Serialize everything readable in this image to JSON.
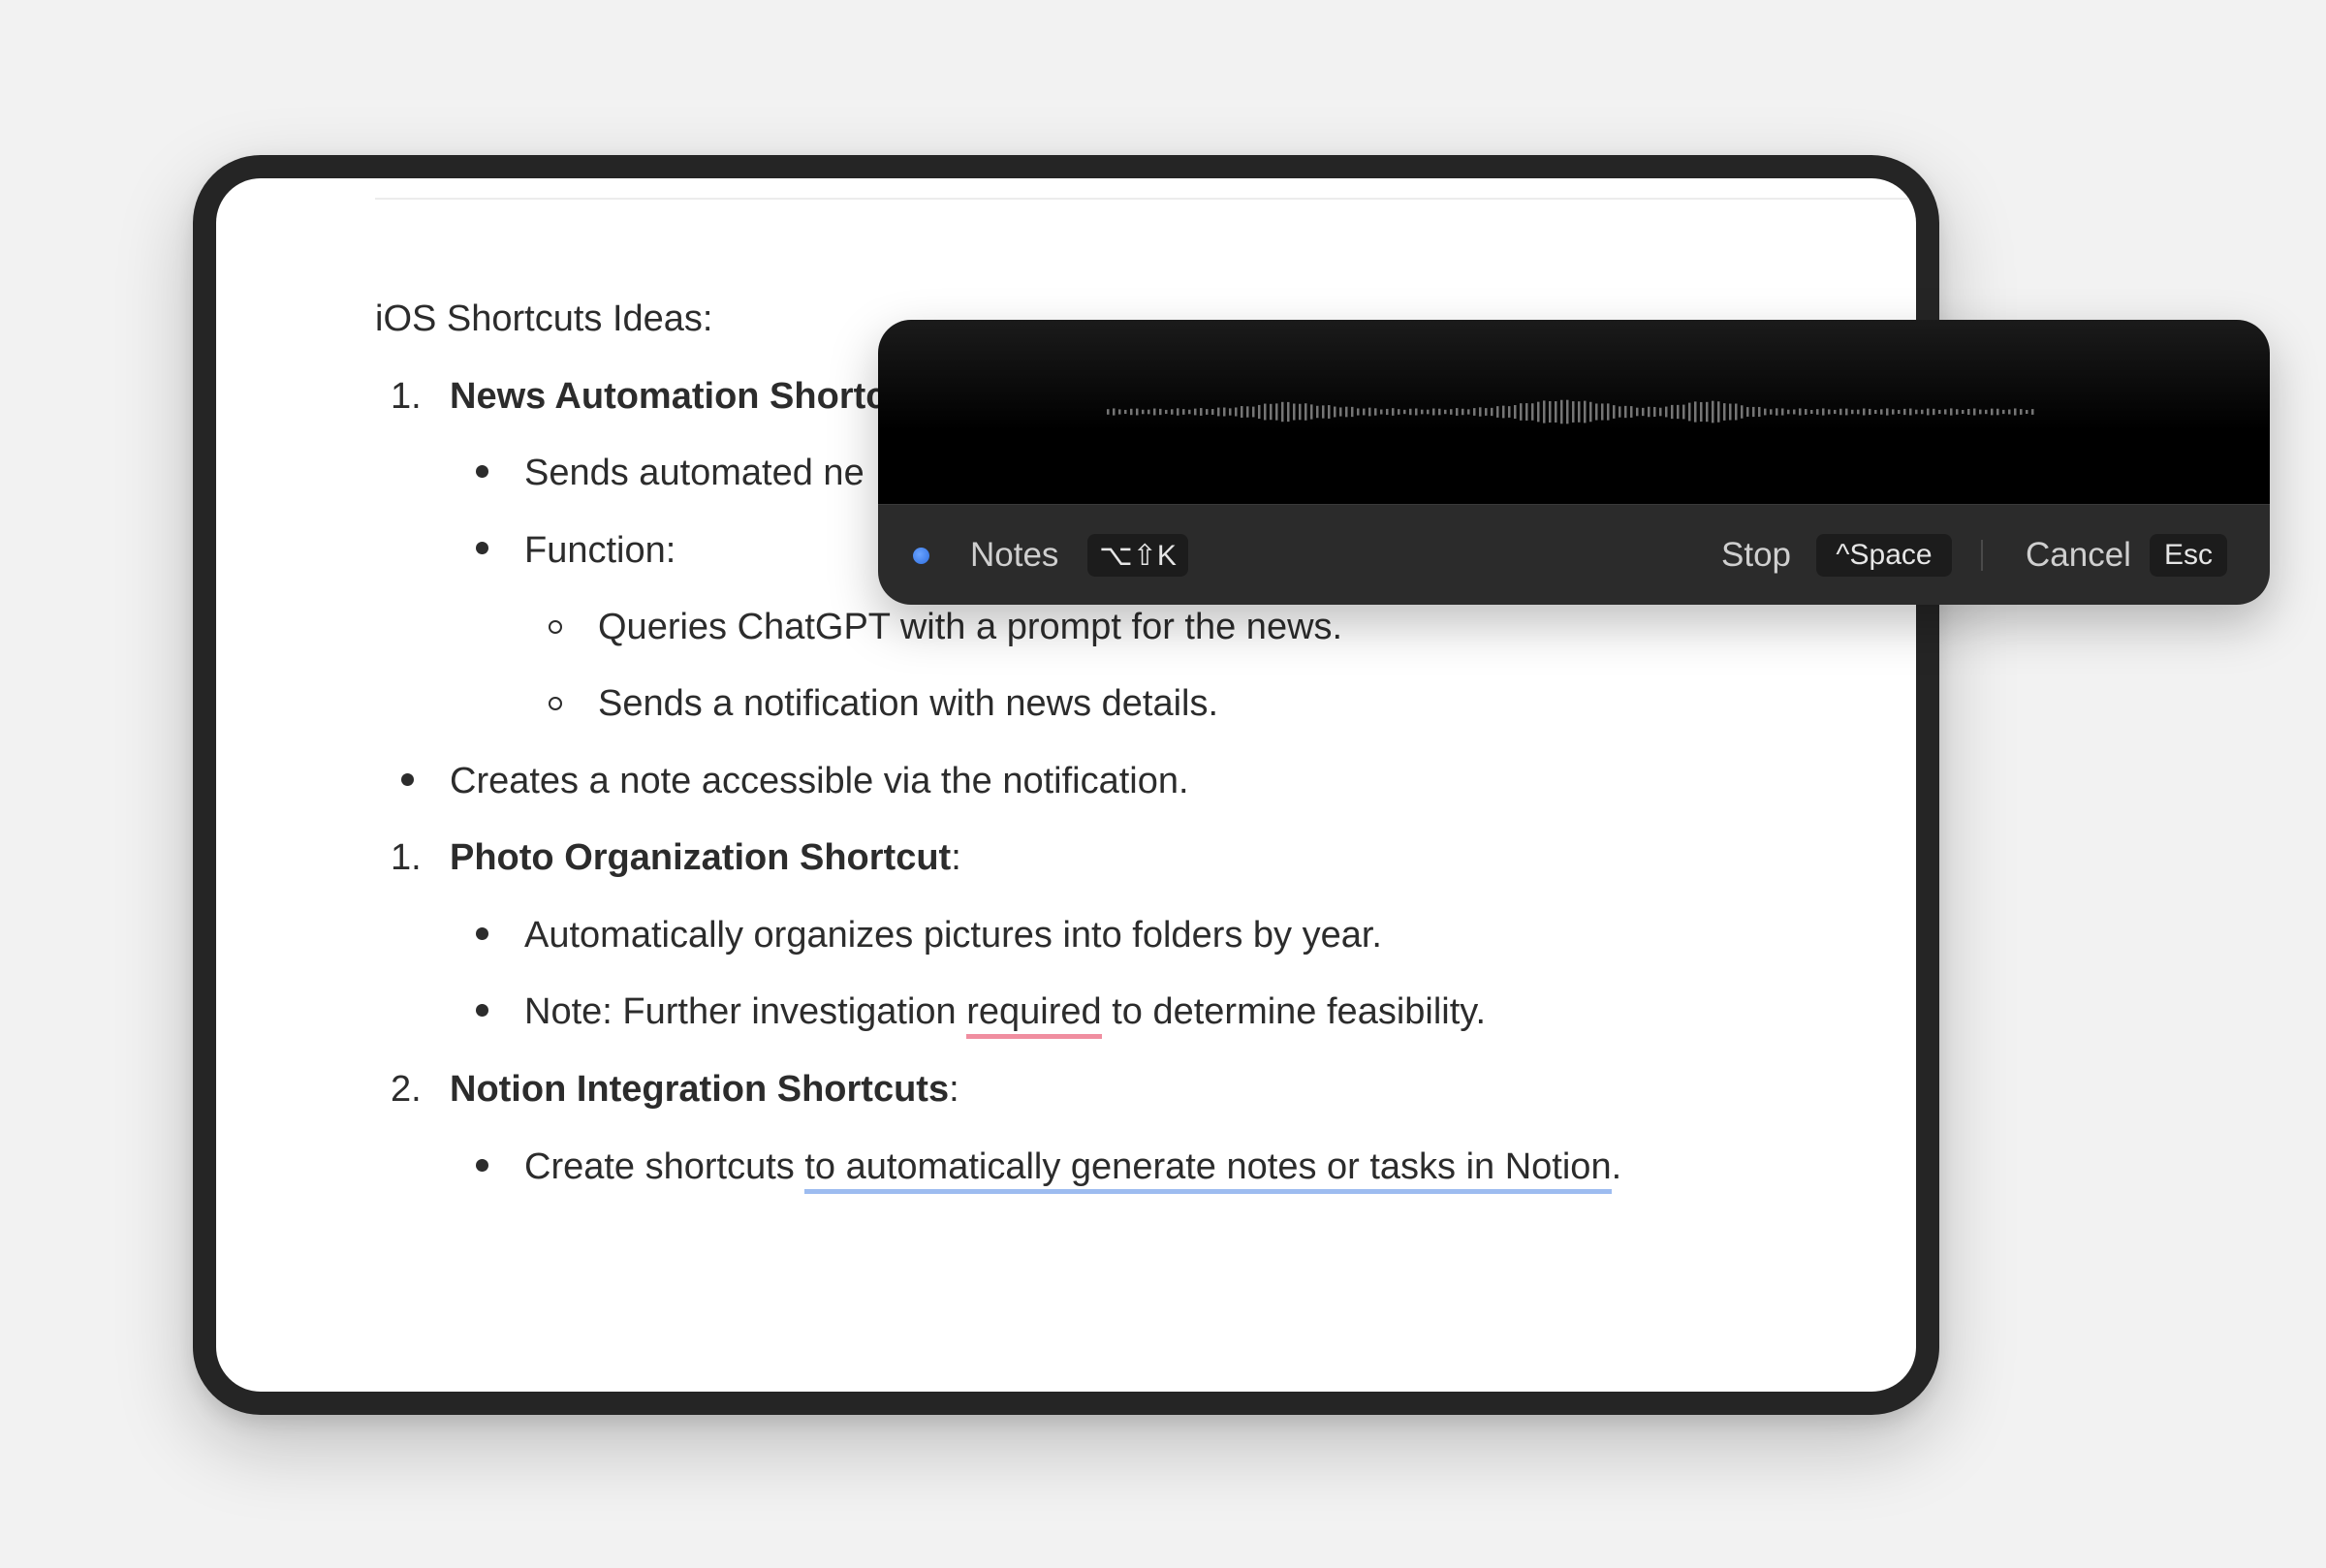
{
  "document": {
    "heading": "iOS Shortcuts Ideas:",
    "item1": {
      "number": "1.",
      "title": "News Automation Shortc"
    },
    "item1_bullets": [
      {
        "text": "Sends automated ne"
      },
      {
        "text": "Function:"
      }
    ],
    "item1_sub": [
      {
        "text": "Queries ChatGPT with a prompt for the news."
      },
      {
        "text": "Sends a notification with news details."
      }
    ],
    "top_bullet": "Creates a note accessible via the notification.",
    "item2": {
      "number": "1.",
      "title": "Photo Organization Shortcut",
      "suffix": ":"
    },
    "item2_bullets": [
      {
        "text": "Automatically organizes pictures into folders by year."
      },
      {
        "pre": "Note: Further investigation ",
        "flag": "required",
        "post": " to determine feasibility."
      }
    ],
    "item3": {
      "number": "2.",
      "title": "Notion Integration Shortcuts",
      "suffix": ":"
    },
    "item3_bullets": [
      {
        "pre": "Create shortcuts ",
        "flag": "to automatically generate notes or tasks in Notion",
        "post": "."
      }
    ]
  },
  "dictation": {
    "app_label": "Notes",
    "app_shortcut": "⌥⇧K",
    "stop_label": "Stop",
    "stop_shortcut": "^Space",
    "cancel_label": "Cancel",
    "cancel_shortcut": "Esc",
    "colors": {
      "record_dot": "#3b7cf0",
      "toolbar": "#2b2b2b",
      "wave": "#8a8a8a"
    }
  },
  "colors": {
    "spell_underline": "#f08ea0",
    "grammar_underline": "#9dbcf0"
  }
}
